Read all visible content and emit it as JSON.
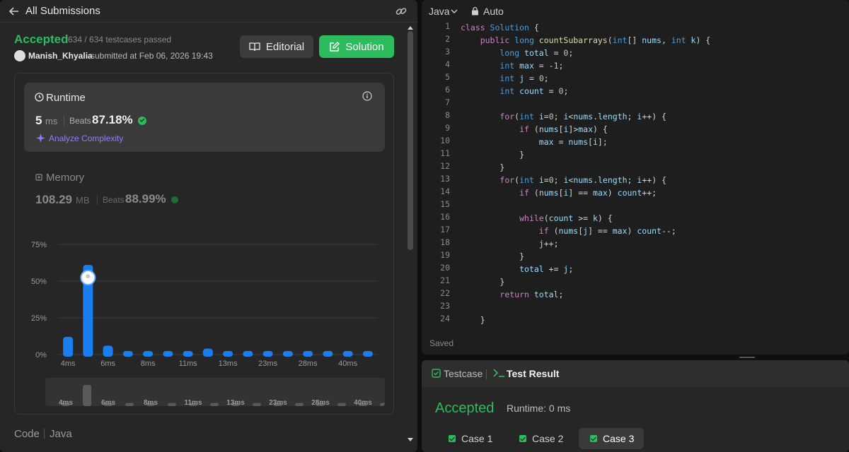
{
  "left": {
    "header": {
      "title": "All Submissions"
    },
    "status": {
      "label": "Accepted",
      "testcases": "634 / 634 testcases passed"
    },
    "submitter": {
      "name": "Manish_Khyalia",
      "submitted_at": "submitted at Feb 06, 2026 19:43"
    },
    "buttons": {
      "editorial": "Editorial",
      "solution": "Solution"
    },
    "runtime": {
      "label": "Runtime",
      "value": "5",
      "unit": "ms",
      "beats_label": "Beats",
      "beats": "87.18%",
      "analyze": "Analyze Complexity"
    },
    "memory": {
      "label": "Memory",
      "value": "108.29",
      "unit": "MB",
      "beats_label": "Beats",
      "beats": "88.99%"
    },
    "footer": {
      "code": "Code",
      "lang": "Java"
    }
  },
  "editor": {
    "language": "Java",
    "mode": "Auto",
    "status": "Saved"
  },
  "code_lines": [
    [
      [
        "kw",
        "class "
      ],
      [
        "ty",
        "Solution "
      ],
      [
        "pl",
        "{"
      ]
    ],
    [
      [
        "pl",
        "    "
      ],
      [
        "kw",
        "public "
      ],
      [
        "ty",
        "long "
      ],
      [
        "fn",
        "countSubarrays"
      ],
      [
        "pl",
        "("
      ],
      [
        "ty",
        "int"
      ],
      [
        "pl",
        "[] "
      ],
      [
        "va",
        "nums"
      ],
      [
        "pl",
        ", "
      ],
      [
        "ty",
        "int "
      ],
      [
        "va",
        "k"
      ],
      [
        "pl",
        ") {"
      ]
    ],
    [
      [
        "pl",
        "        "
      ],
      [
        "ty",
        "long "
      ],
      [
        "va",
        "total"
      ],
      [
        "pl",
        " = "
      ],
      [
        "nu",
        "0"
      ],
      [
        "pl",
        ";"
      ]
    ],
    [
      [
        "pl",
        "        "
      ],
      [
        "ty",
        "int "
      ],
      [
        "va",
        "max"
      ],
      [
        "pl",
        " = -"
      ],
      [
        "nu",
        "1"
      ],
      [
        "pl",
        ";"
      ]
    ],
    [
      [
        "pl",
        "        "
      ],
      [
        "ty",
        "int "
      ],
      [
        "va",
        "j"
      ],
      [
        "pl",
        " = "
      ],
      [
        "nu",
        "0"
      ],
      [
        "pl",
        ";"
      ]
    ],
    [
      [
        "pl",
        "        "
      ],
      [
        "ty",
        "int "
      ],
      [
        "va",
        "count"
      ],
      [
        "pl",
        " = "
      ],
      [
        "nu",
        "0"
      ],
      [
        "pl",
        ";"
      ]
    ],
    [
      [
        "pl",
        ""
      ]
    ],
    [
      [
        "pl",
        "        "
      ],
      [
        "kw",
        "for"
      ],
      [
        "pl",
        "("
      ],
      [
        "ty",
        "int "
      ],
      [
        "va",
        "i"
      ],
      [
        "pl",
        "="
      ],
      [
        "nu",
        "0"
      ],
      [
        "pl",
        "; "
      ],
      [
        "va",
        "i"
      ],
      [
        "pl",
        "<"
      ],
      [
        "va",
        "nums"
      ],
      [
        "pl",
        "."
      ],
      [
        "va",
        "length"
      ],
      [
        "pl",
        "; "
      ],
      [
        "va",
        "i"
      ],
      [
        "pl",
        "++) {"
      ]
    ],
    [
      [
        "pl",
        "            "
      ],
      [
        "kw",
        "if "
      ],
      [
        "pl",
        "("
      ],
      [
        "va",
        "nums"
      ],
      [
        "pl",
        "["
      ],
      [
        "va",
        "i"
      ],
      [
        "pl",
        "]>"
      ],
      [
        "va",
        "max"
      ],
      [
        "pl",
        ") {"
      ]
    ],
    [
      [
        "pl",
        "                "
      ],
      [
        "va",
        "max"
      ],
      [
        "pl",
        " = "
      ],
      [
        "va",
        "nums"
      ],
      [
        "pl",
        "["
      ],
      [
        "va",
        "i"
      ],
      [
        "pl",
        "];"
      ]
    ],
    [
      [
        "pl",
        "            }"
      ]
    ],
    [
      [
        "pl",
        "        }"
      ]
    ],
    [
      [
        "pl",
        "        "
      ],
      [
        "kw",
        "for"
      ],
      [
        "pl",
        "("
      ],
      [
        "ty",
        "int "
      ],
      [
        "va",
        "i"
      ],
      [
        "pl",
        "="
      ],
      [
        "nu",
        "0"
      ],
      [
        "pl",
        "; "
      ],
      [
        "va",
        "i"
      ],
      [
        "pl",
        "<"
      ],
      [
        "va",
        "nums"
      ],
      [
        "pl",
        "."
      ],
      [
        "va",
        "length"
      ],
      [
        "pl",
        "; "
      ],
      [
        "va",
        "i"
      ],
      [
        "pl",
        "++) {"
      ]
    ],
    [
      [
        "pl",
        "            "
      ],
      [
        "kw",
        "if "
      ],
      [
        "pl",
        "("
      ],
      [
        "va",
        "nums"
      ],
      [
        "pl",
        "["
      ],
      [
        "va",
        "i"
      ],
      [
        "pl",
        "] == "
      ],
      [
        "va",
        "max"
      ],
      [
        "pl",
        ") "
      ],
      [
        "va",
        "count"
      ],
      [
        "pl",
        "++;"
      ]
    ],
    [
      [
        "pl",
        ""
      ]
    ],
    [
      [
        "pl",
        "            "
      ],
      [
        "kw",
        "while"
      ],
      [
        "pl",
        "("
      ],
      [
        "va",
        "count"
      ],
      [
        "pl",
        " >= "
      ],
      [
        "va",
        "k"
      ],
      [
        "pl",
        ") {"
      ]
    ],
    [
      [
        "pl",
        "                "
      ],
      [
        "kw",
        "if "
      ],
      [
        "pl",
        "("
      ],
      [
        "va",
        "nums"
      ],
      [
        "pl",
        "["
      ],
      [
        "va",
        "j"
      ],
      [
        "pl",
        "] == "
      ],
      [
        "va",
        "max"
      ],
      [
        "pl",
        ") "
      ],
      [
        "va",
        "count"
      ],
      [
        "pl",
        "--;"
      ]
    ],
    [
      [
        "pl",
        "                "
      ],
      [
        "va",
        "j"
      ],
      [
        "pl",
        "++;"
      ]
    ],
    [
      [
        "pl",
        "            }"
      ]
    ],
    [
      [
        "pl",
        "            "
      ],
      [
        "va",
        "total"
      ],
      [
        "pl",
        " += "
      ],
      [
        "va",
        "j"
      ],
      [
        "pl",
        ";"
      ]
    ],
    [
      [
        "pl",
        "        }"
      ]
    ],
    [
      [
        "pl",
        "        "
      ],
      [
        "kw",
        "return "
      ],
      [
        "va",
        "total"
      ],
      [
        "pl",
        ";"
      ]
    ],
    [
      [
        "pl",
        ""
      ]
    ],
    [
      [
        "pl",
        "    }"
      ]
    ]
  ],
  "line_numbers": [
    "1",
    "2",
    "3",
    "4",
    "5",
    "6",
    "7",
    "8",
    "9",
    "10",
    "11",
    "12",
    "13",
    "14",
    "15",
    "16",
    "17",
    "18",
    "19",
    "20",
    "21",
    "22",
    "23",
    "24"
  ],
  "result": {
    "tab_testcase": "Testcase",
    "tab_result": "Test Result",
    "status": "Accepted",
    "runtime": "Runtime: 0 ms",
    "cases": [
      "Case 1",
      "Case 2",
      "Case 3"
    ],
    "selected_case": "Case 3"
  },
  "colors": {
    "accent_green": "#2cbb5d",
    "bar_blue": "#1a7ef0",
    "bg": "#262626"
  },
  "chart_data": {
    "type": "bar",
    "y_ticks": [
      "75%",
      "50%",
      "25%",
      "0%"
    ],
    "ylim": [
      0,
      75
    ],
    "x_labels": [
      "4ms",
      "6ms",
      "8ms",
      "11ms",
      "13ms",
      "23ms",
      "28ms",
      "40ms"
    ],
    "values": [
      12,
      61,
      6,
      2,
      2,
      2,
      2,
      4,
      2,
      2,
      2,
      2,
      2,
      2,
      2,
      2
    ],
    "highlight_index": 1,
    "mini_values": [
      3,
      20,
      3,
      3,
      3,
      3,
      3,
      3,
      3,
      3,
      3,
      3,
      3,
      3,
      3,
      3
    ],
    "mini_labels": [
      "4ms",
      "6ms",
      "8ms",
      "11ms",
      "13ms",
      "23ms",
      "28ms",
      "40ms"
    ],
    "grid": true
  }
}
